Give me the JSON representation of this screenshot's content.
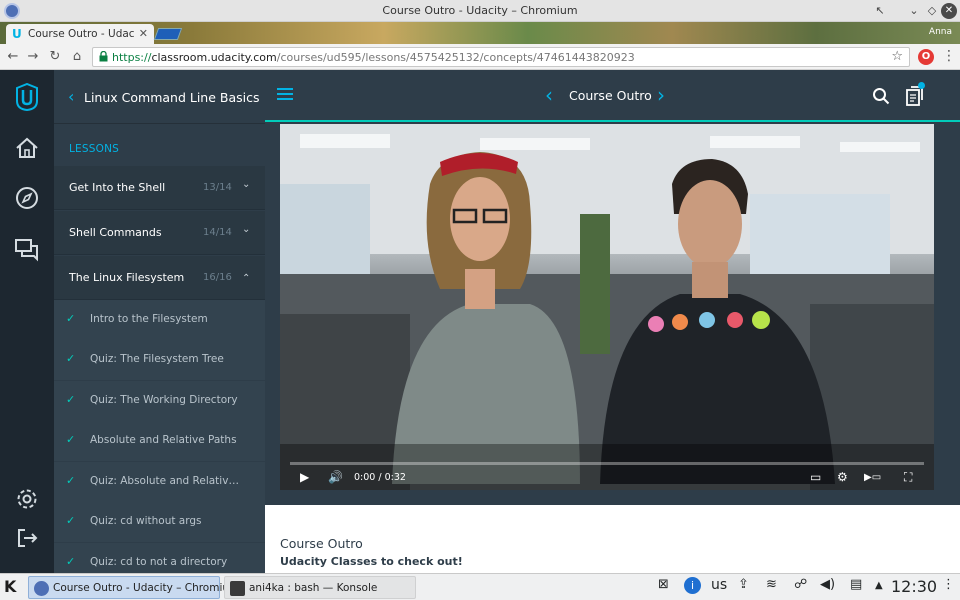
{
  "window": {
    "title": "Course Outro - Udacity – Chromium"
  },
  "browser": {
    "tab_title": "Course Outro - Udacity",
    "profile_name": "Anna",
    "url_scheme": "https://",
    "url_host": "classroom.udacity.com",
    "url_path": "/courses/ud595/lessons/4575425132/concepts/47461443820923",
    "extension_badge": "O"
  },
  "sidebar": {
    "course_title": "Linux Command Line Basics",
    "lessons_label": "LESSONS",
    "lessons": [
      {
        "name": "Get Into the Shell",
        "progress": "13/14",
        "expanded": false
      },
      {
        "name": "Shell Commands",
        "progress": "14/14",
        "expanded": false
      },
      {
        "name": "The Linux Filesystem",
        "progress": "16/16",
        "expanded": true
      }
    ],
    "concepts": [
      "Intro to the Filesystem",
      "Quiz: The Filesystem Tree",
      "Quiz: The Working Directory",
      "Absolute and Relative Paths",
      "Quiz: Absolute and Relative Paths",
      "Quiz: cd without args",
      "Quiz: cd to not a directory"
    ]
  },
  "topbar": {
    "concept_title": "Course Outro"
  },
  "video": {
    "time": "0:00 / 0:32",
    "played_fraction": 0.0
  },
  "content": {
    "title": "Course Outro",
    "subtitle": "Udacity Classes to check out!"
  },
  "taskbar": {
    "tasks": [
      {
        "label": "Course Outro - Udacity – Chromium",
        "active": true
      },
      {
        "label": "ani4ka : bash — Konsole",
        "active": false
      }
    ],
    "keyboard_layout": "us",
    "clock": "12:30"
  },
  "colors": {
    "accent": "#02b3e4",
    "check": "#02ccba",
    "sidebar": "#2e3d49",
    "rail": "#1d2730"
  }
}
